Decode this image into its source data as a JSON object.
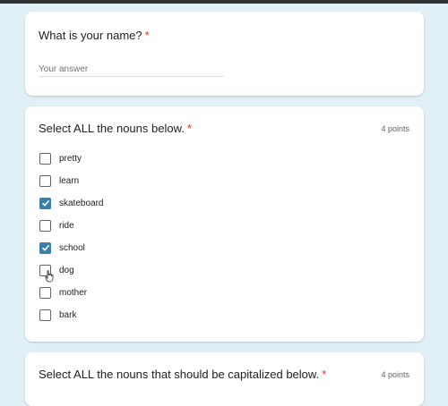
{
  "q1": {
    "title": "What is your name?",
    "required_mark": "*",
    "answer_value": "",
    "placeholder": "Your answer"
  },
  "q2": {
    "title": "Select ALL the nouns below.",
    "required_mark": "*",
    "points": "4 points",
    "options": [
      {
        "label": "pretty",
        "checked": false
      },
      {
        "label": "learn",
        "checked": false
      },
      {
        "label": "skateboard",
        "checked": true
      },
      {
        "label": "ride",
        "checked": false
      },
      {
        "label": "school",
        "checked": true
      },
      {
        "label": "dog",
        "checked": false
      },
      {
        "label": "mother",
        "checked": false
      },
      {
        "label": "bark",
        "checked": false
      }
    ]
  },
  "q3": {
    "title": "Select ALL the nouns that should be capitalized below.",
    "required_mark": "*",
    "points": "4 points"
  },
  "colors": {
    "accent": "#3b7fa8",
    "required": "#d93025",
    "background": "#e0f0f6"
  },
  "icons": {
    "checked": "checkmark-icon",
    "cursor": "hand-pointer-icon"
  }
}
